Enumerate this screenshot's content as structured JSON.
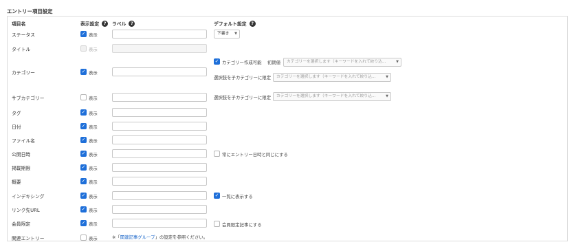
{
  "section": {
    "title": "エントリー項目設定"
  },
  "headers": {
    "item_name": "項目名",
    "display": "表示設定",
    "label": "ラベル",
    "default": "デフォルト設定"
  },
  "display_label": "表示",
  "rows": [
    {
      "name": "ステータス",
      "checked": true,
      "disabled": false
    },
    {
      "name": "タイトル",
      "checked": false,
      "disabled": true
    },
    {
      "name": "カテゴリー",
      "checked": true,
      "disabled": false
    },
    {
      "name": "サブカテゴリー",
      "checked": false,
      "disabled": false
    },
    {
      "name": "タグ",
      "checked": true,
      "disabled": false
    },
    {
      "name": "日付",
      "checked": true,
      "disabled": false
    },
    {
      "name": "ファイル名",
      "checked": true,
      "disabled": false
    },
    {
      "name": "公開日時",
      "checked": true,
      "disabled": false
    },
    {
      "name": "掲載期限",
      "checked": true,
      "disabled": false
    },
    {
      "name": "概要",
      "checked": true,
      "disabled": false
    },
    {
      "name": "インデキシング",
      "checked": true,
      "disabled": false
    },
    {
      "name": "リンク先URL",
      "checked": true,
      "disabled": false
    },
    {
      "name": "会員限定",
      "checked": true,
      "disabled": false
    },
    {
      "name": "関連エントリー",
      "checked": false,
      "disabled": false
    }
  ],
  "defaults": {
    "status_select": "下書き",
    "category_creatable_label": "カテゴリー作成可能",
    "category_creatable_checked": true,
    "initial_value_label": "初期値",
    "category_placeholder": "カテゴリーを選択します（キーワードを入れて絞り込...",
    "limit_child_label": "選択肢を子カテゴリーに限定",
    "limit_child_placeholder": "カテゴリーを選択します（キーワードを入れて絞り込...",
    "sub_limit_child_label": "選択肢を子カテゴリーに限定",
    "sub_limit_child_placeholder": "カテゴリーを選択します（キーワードを入れて絞り込...",
    "same_as_entry_date_label": "常にエントリー日時と同じにする",
    "same_as_entry_date_checked": false,
    "indexing_always_label": "一覧に表示する",
    "indexing_always_checked": true,
    "members_only_label": "会員限定記事にする",
    "members_only_checked": false
  },
  "related_note": {
    "prefix": "※「",
    "link": "関連記事グループ",
    "suffix": "」の設定を参照ください。"
  }
}
